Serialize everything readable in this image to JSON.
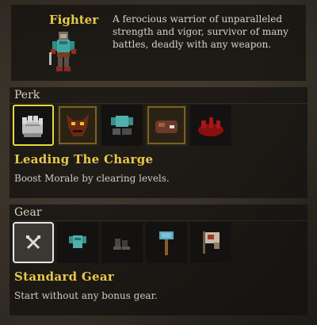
{
  "class_info": {
    "name": "Fighter",
    "description": "A ferocious warrior of unparalleled strength and vigor, survivor of many battles, deadly with any weapon."
  },
  "perk": {
    "header": "Perk",
    "selected_title": "Leading The Charge",
    "selected_description": "Boost Morale by clearing levels.",
    "slots": [
      {
        "icon": "gauntlet-fist-icon",
        "selected": true
      },
      {
        "icon": "demon-mask-icon",
        "selected": false
      },
      {
        "icon": "armor-bundle-icon",
        "selected": false
      },
      {
        "icon": "meat-chunk-icon",
        "selected": false
      },
      {
        "icon": "blood-pool-icon",
        "selected": false
      }
    ]
  },
  "gear": {
    "header": "Gear",
    "selected_title": "Standard Gear",
    "selected_description": "Start without any bonus gear.",
    "slots": [
      {
        "icon": "crossed-swords-icon",
        "selected": true
      },
      {
        "icon": "teal-armor-icon",
        "selected": false
      },
      {
        "icon": "dark-boots-icon",
        "selected": false
      },
      {
        "icon": "war-hammer-icon",
        "selected": false
      },
      {
        "icon": "flag-scroll-icon",
        "selected": false
      }
    ]
  },
  "colors": {
    "title_gold": "#e8c94a",
    "selected_perk_border": "#e3d93a",
    "selected_gear_border": "#e8e8e8"
  }
}
